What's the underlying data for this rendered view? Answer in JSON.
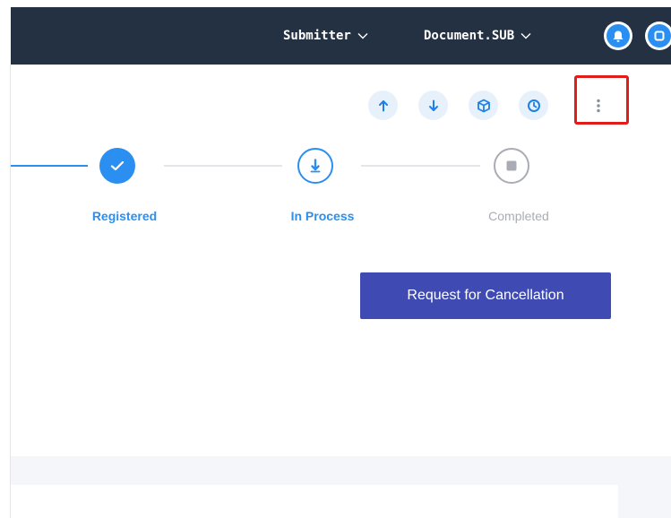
{
  "topbar": {
    "role_label": "Submitter",
    "document_label": "Document.SUB"
  },
  "toolbar": {
    "actions": [
      {
        "icon": "arrow-up-icon"
      },
      {
        "icon": "arrow-down-icon"
      },
      {
        "icon": "package-icon"
      },
      {
        "icon": "clock-icon"
      },
      {
        "icon": "more-vertical-icon"
      }
    ]
  },
  "stepper": {
    "steps": [
      {
        "label": "Registered",
        "status": "done"
      },
      {
        "label": "In Process",
        "status": "active"
      },
      {
        "label": "Completed",
        "status": "pending"
      }
    ]
  },
  "actions": {
    "cancel_label": "Request for Cancellation"
  },
  "colors": {
    "topbar_bg": "#243142",
    "accent": "#2a8ff0",
    "primary_button": "#3f4bb3",
    "highlight": "#e21b1b",
    "pending": "#a9adb3"
  }
}
